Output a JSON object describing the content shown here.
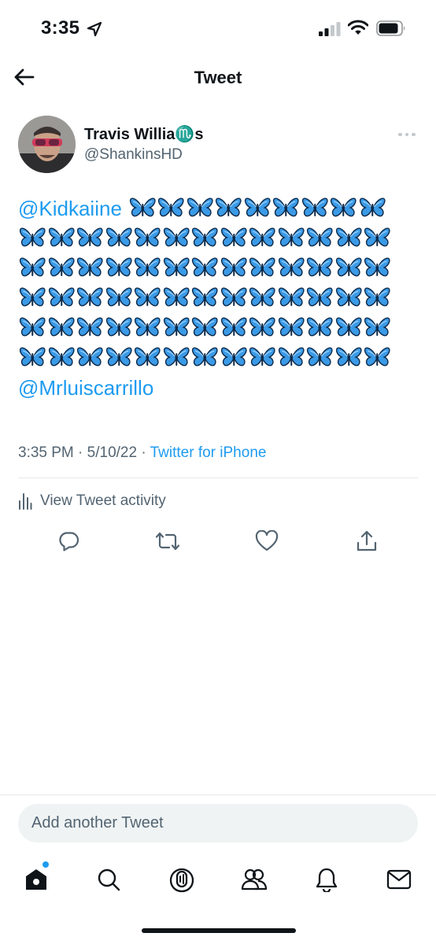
{
  "status_bar": {
    "time": "3:35"
  },
  "header": {
    "title": "Tweet"
  },
  "author": {
    "name": "Travis Willia♏️s",
    "handle": "@ShankinsHD"
  },
  "tweet": {
    "mention_1": "@Kidkaiine",
    "butterfly_emoji": "🦋",
    "butterfly_rows": [
      9,
      13,
      13,
      13,
      13,
      13
    ],
    "mention_2": "@Mrluiscarrillo"
  },
  "meta": {
    "time": "3:35 PM",
    "date": "5/10/22",
    "separator": "·",
    "source": "Twitter for iPhone"
  },
  "activity": {
    "label": "View Tweet activity"
  },
  "reply": {
    "placeholder": "Add another Tweet"
  },
  "colors": {
    "accent": "#1d9bf0",
    "text": "#0f1419",
    "muted": "#536471",
    "divider": "#e5e8eb"
  },
  "icons": {
    "actions": [
      "reply-icon",
      "retweet-icon",
      "like-icon",
      "share-icon"
    ],
    "tabs": [
      "home-icon",
      "search-icon",
      "spaces-icon",
      "communities-icon",
      "notifications-icon",
      "messages-icon"
    ]
  }
}
